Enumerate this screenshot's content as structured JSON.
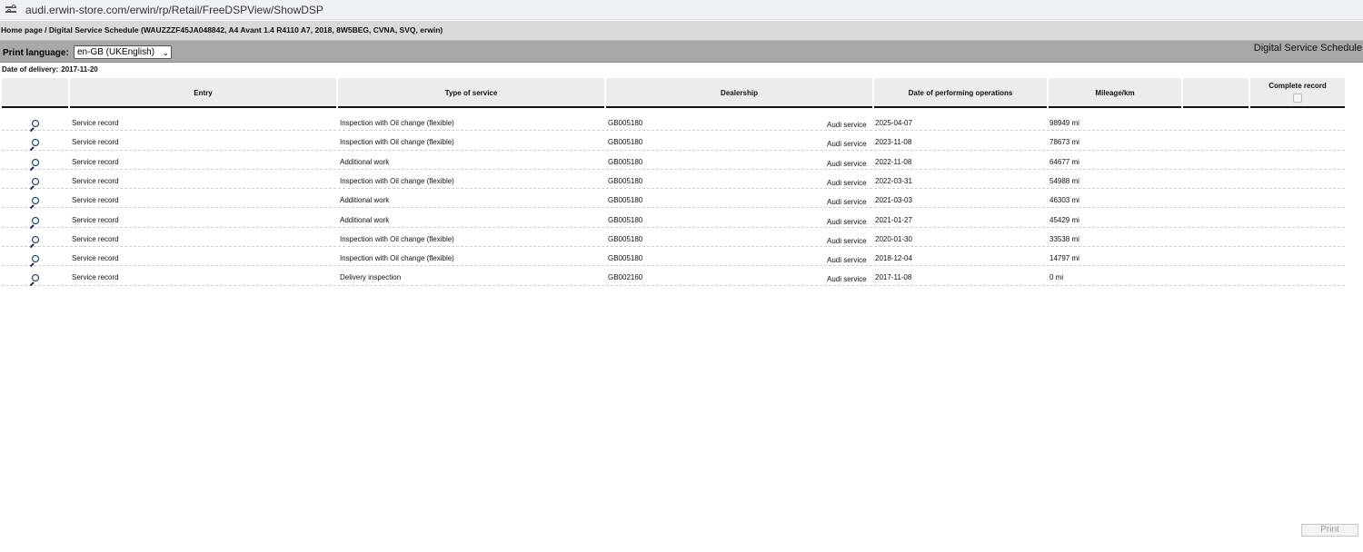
{
  "browser": {
    "url": "audi.erwin-store.com/erwin/rp/Retail/FreeDSPView/ShowDSP",
    "site_info_icon": "tune-icon"
  },
  "breadcrumb": {
    "text": "Home page / Digital Service Schedule (WAUZZZF45JA048842, A4 Avant 1.4 R4110 A7, 2018, 8W5BEG, CVNA, SVQ, erwin)"
  },
  "toolbar": {
    "print_language_label": "Print language:",
    "language_selected": "en-GB (UKEnglish)",
    "page_title": "Digital Service Schedule"
  },
  "delivery": {
    "label": "Date of delivery:",
    "value": "2017-11-20"
  },
  "table": {
    "headers": {
      "entry": "Entry",
      "type": "Type of service",
      "dealership": "Dealership",
      "date": "Date of performing operations",
      "mileage": "Mileage/km",
      "complete": "Complete record"
    },
    "rows": [
      {
        "entry": "Service record",
        "type": "Inspection with Oil change (flexible)",
        "dealer_code": "GB005180",
        "dealer_name": "Audi service",
        "date": "2025-04-07",
        "mileage": "98949 mi"
      },
      {
        "entry": "Service record",
        "type": "Inspection with Oil change (flexible)",
        "dealer_code": "GB005180",
        "dealer_name": "Audi service",
        "date": "2023-11-08",
        "mileage": "78673 mi"
      },
      {
        "entry": "Service record",
        "type": "Additional work",
        "dealer_code": "GB005180",
        "dealer_name": "Audi service",
        "date": "2022-11-08",
        "mileage": "64677 mi"
      },
      {
        "entry": "Service record",
        "type": "Inspection with Oil change (flexible)",
        "dealer_code": "GB005180",
        "dealer_name": "Audi service",
        "date": "2022-03-31",
        "mileage": "54988 mi"
      },
      {
        "entry": "Service record",
        "type": "Additional work",
        "dealer_code": "GB005180",
        "dealer_name": "Audi service",
        "date": "2021-03-03",
        "mileage": "46303 mi"
      },
      {
        "entry": "Service record",
        "type": "Additional work",
        "dealer_code": "GB005180",
        "dealer_name": "Audi service",
        "date": "2021-01-27",
        "mileage": "45429 mi"
      },
      {
        "entry": "Service record",
        "type": "Inspection with Oil change (flexible)",
        "dealer_code": "GB005180",
        "dealer_name": "Audi service",
        "date": "2020-01-30",
        "mileage": "33538 mi"
      },
      {
        "entry": "Service record",
        "type": "Inspection with Oil change (flexible)",
        "dealer_code": "GB005180",
        "dealer_name": "Audi service",
        "date": "2018-12-04",
        "mileage": "14797 mi"
      },
      {
        "entry": "Service record",
        "type": "Delivery inspection",
        "dealer_code": "GB002160",
        "dealer_name": "Audi service",
        "date": "2017-11-08",
        "mileage": "0 mi"
      }
    ]
  },
  "footer": {
    "print_label": "Print"
  }
}
